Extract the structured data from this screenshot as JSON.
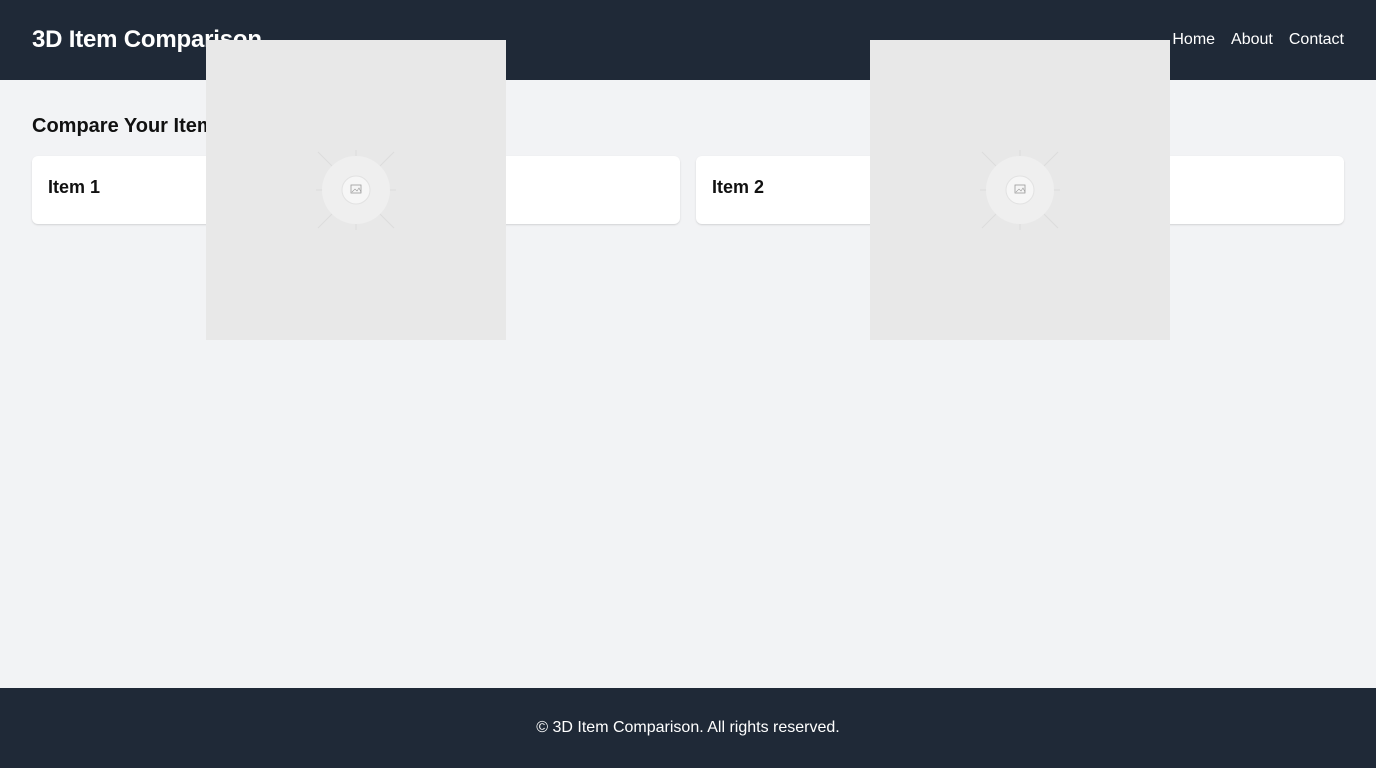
{
  "header": {
    "title": "3D Item Comparison",
    "nav": [
      "Home",
      "About",
      "Contact"
    ]
  },
  "main": {
    "heading": "Compare Your Items",
    "items": [
      {
        "title": "Item 1"
      },
      {
        "title": "Item 2"
      }
    ],
    "viewer_icon": "image-placeholder-icon"
  },
  "footer": {
    "text": "© 3D Item Comparison. All rights reserved."
  },
  "colors": {
    "header_bg": "#1f2937",
    "page_bg": "#f2f3f5",
    "card_bg": "#ffffff",
    "viewer_bg": "#e8e8e8"
  }
}
